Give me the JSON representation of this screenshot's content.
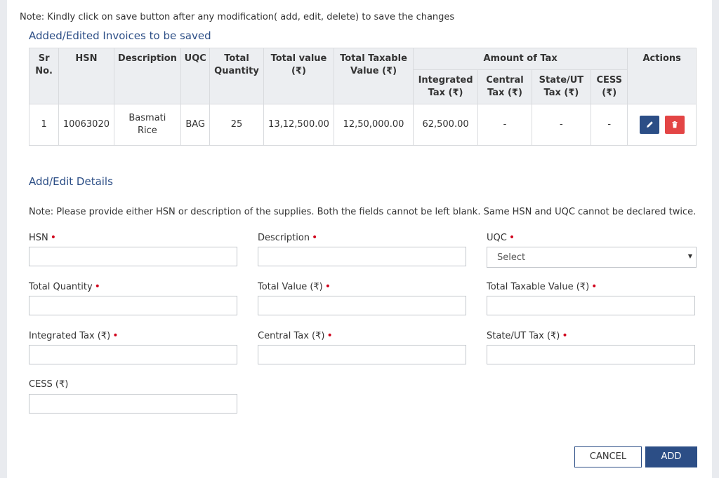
{
  "top_note": "Note: Kindly click on save button after any modification( add, edit, delete) to save the changes",
  "invoices_title": "Added/Edited Invoices to be saved",
  "table": {
    "headers": {
      "sr": "Sr No.",
      "hsn": "HSN",
      "description": "Description",
      "uqc": "UQC",
      "total_quantity": "Total Quantity",
      "total_value": "Total value (₹)",
      "total_taxable": "Total Taxable Value (₹)",
      "amount_of_tax": "Amount of Tax",
      "integrated": "Integrated Tax (₹)",
      "central": "Central Tax (₹)",
      "state": "State/UT Tax (₹)",
      "cess": "CESS (₹)",
      "actions": "Actions"
    },
    "rows": [
      {
        "sr": "1",
        "hsn": "10063020",
        "description": "Basmati Rice",
        "uqc": "BAG",
        "total_quantity": "25",
        "total_value": "13,12,500.00",
        "total_taxable": "12,50,000.00",
        "integrated": "62,500.00",
        "central": "-",
        "state": "-",
        "cess": "-"
      }
    ]
  },
  "form": {
    "title": "Add/Edit Details",
    "note": "Note: Please provide either HSN or description of the supplies. Both the fields cannot be left blank. Same HSN and UQC cannot be declared twice.",
    "required_mark": "•",
    "hsn_label": "HSN",
    "description_label": "Description",
    "uqc_label": "UQC",
    "uqc_selected": "Select",
    "total_quantity_label": "Total Quantity",
    "total_value_label": "Total Value (₹)",
    "total_taxable_label": "Total Taxable Value (₹)",
    "integrated_label": "Integrated Tax (₹)",
    "central_label": "Central Tax (₹)",
    "state_label": "State/UT Tax (₹)",
    "cess_label": "CESS (₹)"
  },
  "buttons": {
    "cancel": "CANCEL",
    "add": "ADD"
  },
  "icons": {
    "edit": "pencil-icon",
    "delete": "trash-icon"
  },
  "colors": {
    "primary": "#2c4e86",
    "danger": "#e34545",
    "required": "#d0021b"
  }
}
